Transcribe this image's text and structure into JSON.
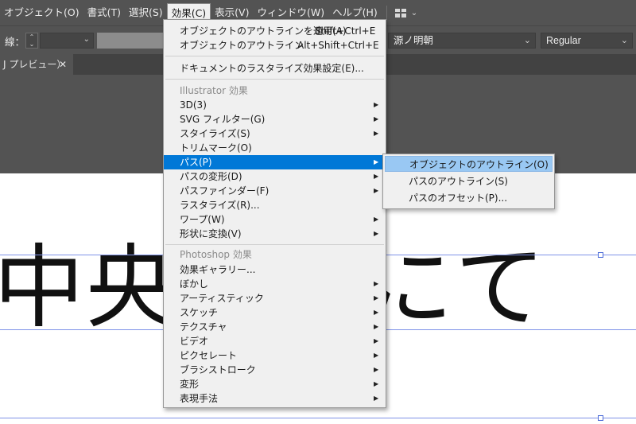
{
  "menubar": {
    "items": [
      "オブジェクト(O)",
      "書式(T)",
      "選択(S)",
      "効果(C)",
      "表示(V)",
      "ウィンドウ(W)",
      "ヘルプ(H)"
    ],
    "active_index": 3
  },
  "controlbar": {
    "stroke_label": "線：",
    "font_family": "源ノ明朝",
    "font_style": "Regular"
  },
  "tab": {
    "label": "J プレビュー）",
    "close_glyph": "✕"
  },
  "canvas": {
    "text": "中央　えにて"
  },
  "effect_menu": {
    "apply_label": "オブジェクトのアウトラインを適用(A)",
    "apply_shortcut": "Shift+Ctrl+E",
    "outline_label": "オブジェクトのアウトライン",
    "outline_shortcut": "Alt+Shift+Ctrl+E",
    "raster_settings": "ドキュメントのラスタライズ効果設定(E)...",
    "illustrator_header": "Illustrator 効果",
    "illustrator_items": [
      "3D(3)",
      "SVG フィルター(G)",
      "スタイライズ(S)",
      "トリムマーク(O)",
      "パス(P)",
      "パスの変形(D)",
      "パスファインダー(F)",
      "ラスタライズ(R)...",
      "ワープ(W)",
      "形状に変換(V)"
    ],
    "photoshop_header": "Photoshop 効果",
    "photoshop_items": [
      "効果ギャラリー...",
      "ぼかし",
      "アーティスティック",
      "スケッチ",
      "テクスチャ",
      "ビデオ",
      "ピクセレート",
      "ブラシストローク",
      "変形",
      "表現手法"
    ],
    "submenu_arrow": "▶"
  },
  "submenu": {
    "items": [
      "オブジェクトのアウトライン(O)",
      "パスのアウトライン(S)",
      "パスのオフセット(P)..."
    ]
  },
  "colors": {
    "ui_dark": "#535353",
    "menu_bg": "#f0f0f0",
    "highlight": "#0078d7",
    "sub_highlight": "#99c8f3",
    "guide": "#7f93e8"
  }
}
